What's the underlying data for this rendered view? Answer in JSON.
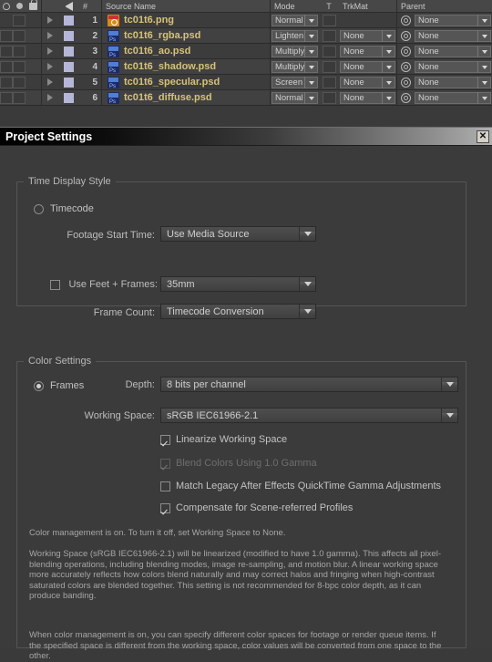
{
  "timeline": {
    "columns": [
      "#",
      "Source Name",
      "Mode",
      "T",
      "TrkMat",
      "Parent"
    ],
    "col_hash": "#",
    "col_source_name": "Source Name",
    "col_mode": "Mode",
    "col_t": "T",
    "col_trkmat": "TrkMat",
    "col_parent": "Parent",
    "icons": [
      "eye-icon",
      "audio-icon",
      "lock-icon",
      "label-tag-icon"
    ],
    "rows": [
      {
        "num": "1",
        "name": "tc01t6.png",
        "type": "png",
        "mode": "Normal",
        "trkmat": "",
        "parent": "None"
      },
      {
        "num": "2",
        "name": "tc01t6_rgba.psd",
        "type": "psd",
        "mode": "Lighten",
        "trkmat": "None",
        "parent": "None"
      },
      {
        "num": "3",
        "name": "tc01t6_ao.psd",
        "type": "psd",
        "mode": "Multiply",
        "trkmat": "None",
        "parent": "None"
      },
      {
        "num": "4",
        "name": "tc01t6_shadow.psd",
        "type": "psd",
        "mode": "Multiply",
        "trkmat": "None",
        "parent": "None"
      },
      {
        "num": "5",
        "name": "tc01t6_specular.psd",
        "type": "psd",
        "mode": "Screen",
        "trkmat": "None",
        "parent": "None"
      },
      {
        "num": "6",
        "name": "tc01t6_diffuse.psd",
        "type": "psd",
        "mode": "Normal",
        "trkmat": "None",
        "parent": "None"
      }
    ],
    "colors": {
      "layer_name": "#d6c27a",
      "label_swatch": "#b6b6d8",
      "panel_bg": "#3a3a3a"
    }
  },
  "dialog": {
    "title": "Project Settings",
    "close_label": "✕",
    "time_display_style": {
      "legend": "Time Display Style",
      "timecode_label": "Timecode",
      "timecode_selected": false,
      "footage_start_time_label": "Footage Start Time:",
      "footage_start_time_value": "Use Media Source",
      "frames_label": "Frames",
      "frames_selected": true,
      "use_feet_frames_label": "Use Feet + Frames:",
      "use_feet_frames_checked": false,
      "use_feet_frames_value": "35mm",
      "frame_count_label": "Frame Count:",
      "frame_count_value": "Timecode Conversion"
    },
    "color_settings": {
      "legend": "Color Settings",
      "depth_label": "Depth:",
      "depth_value": "8 bits per channel",
      "working_space_label": "Working Space:",
      "working_space_value": "sRGB IEC61966-2.1",
      "linearize_label": "Linearize Working Space",
      "linearize_checked": true,
      "blend_gamma_label": "Blend Colors Using 1.0 Gamma",
      "blend_gamma_checked": true,
      "blend_gamma_disabled": true,
      "match_legacy_label": "Match Legacy After Effects QuickTime Gamma Adjustments",
      "match_legacy_checked": false,
      "compensate_label": "Compensate for Scene-referred Profiles",
      "compensate_checked": true,
      "note_1": "Color management is on. To turn it off, set Working Space to None.",
      "note_2": "Working Space (sRGB IEC61966-2.1) will be linearized (modified to have 1.0 gamma). This affects all pixel-blending operations, including blending modes, image re-sampling, and motion blur. A linear working space more accurately reflects how colors blend naturally and may correct halos and fringing when high-contrast saturated colors are blended together. This setting is not recommended for 8-bpc color depth, as it can produce banding.",
      "note_3": "When color management is on, you can specify different color spaces for footage or render queue items. If the specified space is different from the working space, color values will be converted from one space to the other."
    }
  }
}
